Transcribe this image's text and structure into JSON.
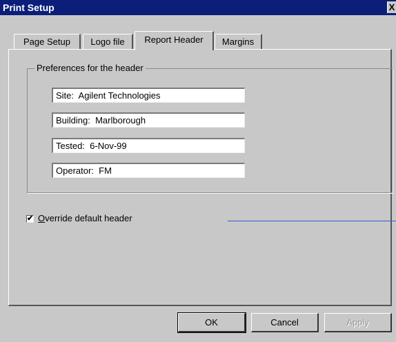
{
  "window": {
    "title": "Print Setup",
    "close_label": "X"
  },
  "tabs": [
    {
      "label": "Page Setup"
    },
    {
      "label": "Logo file"
    },
    {
      "label": "Report Header",
      "active": true
    },
    {
      "label": "Margins"
    }
  ],
  "header_prefs": {
    "group_label": "Preferences for the header",
    "fields": [
      {
        "value": "Site:  Agilent Technologies"
      },
      {
        "value": "Building:  Marlborough"
      },
      {
        "value": "Tested:  6-Nov-99"
      },
      {
        "value": "Operator:  FM"
      }
    ]
  },
  "override": {
    "checked": true,
    "check_mark": "✔",
    "label_accel": "O",
    "label_rest": "verride default header"
  },
  "buttons": {
    "ok": "OK",
    "cancel": "Cancel",
    "apply": "Apply"
  },
  "colors": {
    "titlebar": "#0a1e7a",
    "face": "#c8c8c8",
    "line": "#2e5bd6"
  }
}
